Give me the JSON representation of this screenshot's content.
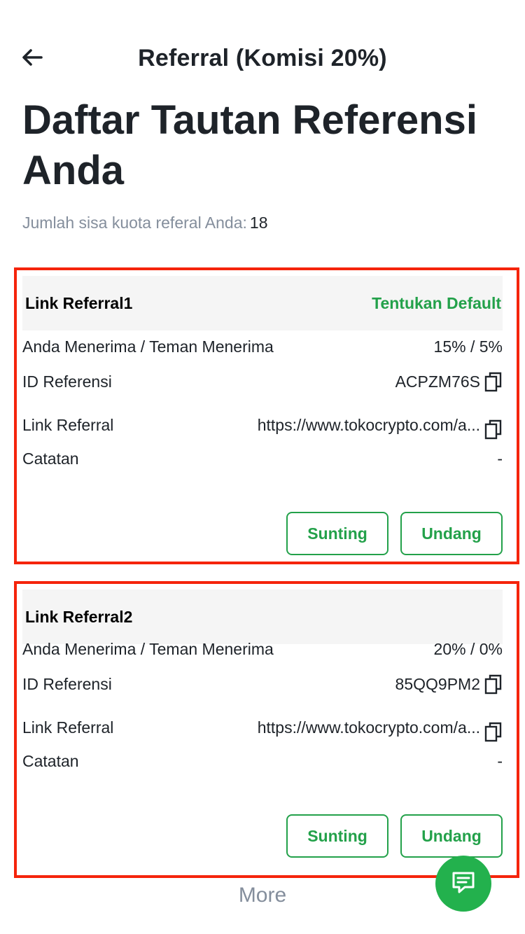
{
  "header": {
    "title": "Referral (Komisi 20%)"
  },
  "page_title": "Daftar Tautan Referensi Anda",
  "quota": {
    "label": "Jumlah sisa kuota referal Anda:",
    "value": "18"
  },
  "labels": {
    "rate": "Anda Menerima / Teman Menerima",
    "ref_id": "ID Referensi",
    "link": "Link Referral",
    "note": "Catatan"
  },
  "cards": [
    {
      "name": "Link Referral1",
      "default_action": "Tentukan Default",
      "rate": "15% / 5%",
      "ref_id": "ACPZM76S",
      "link": "https://www.tokocrypto.com/a...",
      "note": "-",
      "edit_label": "Sunting",
      "invite_label": "Undang"
    },
    {
      "name": "Link Referral2",
      "default_action": "",
      "rate": "20% / 0%",
      "ref_id": "85QQ9PM2",
      "link": "https://www.tokocrypto.com/a...",
      "note": "-",
      "edit_label": "Sunting",
      "invite_label": "Undang"
    }
  ],
  "more_label": "More",
  "colors": {
    "accent": "#23a14a",
    "highlight_border": "#f5240b",
    "fab": "#23b14d"
  },
  "icons": {
    "back": "arrow-left-icon",
    "copy": "copy-icon",
    "chat": "chat-icon"
  }
}
